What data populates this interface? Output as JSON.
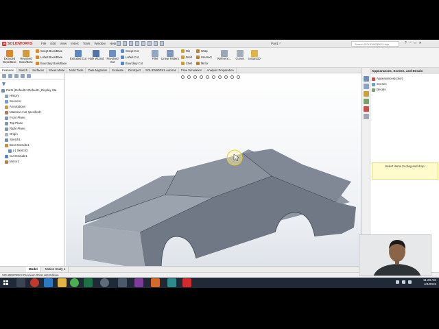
{
  "app": {
    "name": "SOLIDWORKS",
    "document_title": "Part1 *",
    "search_placeholder": "Search SOLIDWORKS Help",
    "menus": [
      "File",
      "Edit",
      "View",
      "Insert",
      "Tools",
      "Window",
      "Help"
    ]
  },
  "command_manager": {
    "extruded_boss": "Extruded Boss/Base",
    "revolved_boss": "Revolved Boss/Base",
    "swept_boss": "Swept Boss/Base",
    "lofted_boss": "Lofted Boss/Base",
    "boundary_boss": "Boundary Boss/Base",
    "extruded_cut": "Extruded Cut",
    "hole_wizard": "Hole Wizard",
    "revolved_cut": "Revolved Cut",
    "swept_cut": "Swept Cut",
    "lofted_cut": "Lofted Cut",
    "boundary_cut": "Boundary Cut",
    "fillet": "Fillet",
    "linear_pattern": "Linear Pattern",
    "rib": "Rib",
    "draft": "Draft",
    "shell": "Shell",
    "wrap": "Wrap",
    "intersect": "Intersect",
    "mirror": "Mirror",
    "reference": "Referenc...",
    "curves": "Curves",
    "instant3d": "Instant3D"
  },
  "tabs": [
    "Features",
    "Sketch",
    "Surfaces",
    "Sheet Metal",
    "Mold Tools",
    "Data Migration",
    "Evaluate",
    "DimXpert",
    "SOLIDWORKS Add-Ins",
    "Flow Simulation",
    "Analysis Preparation"
  ],
  "tree": {
    "root": "Part1 (Default<<Default>_Display Sta",
    "items": [
      {
        "label": "History",
        "indent": 1,
        "icon": "history-icon"
      },
      {
        "label": "Sensors",
        "indent": 1,
        "icon": "sensor-icon"
      },
      {
        "label": "Annotations",
        "indent": 1,
        "icon": "annotation-icon"
      },
      {
        "label": "Material <not specified>",
        "indent": 1,
        "icon": "material-icon"
      },
      {
        "label": "Front Plane",
        "indent": 1,
        "icon": "plane-icon"
      },
      {
        "label": "Top Plane",
        "indent": 1,
        "icon": "plane-icon"
      },
      {
        "label": "Right Plane",
        "indent": 1,
        "icon": "plane-icon"
      },
      {
        "label": "Origin",
        "indent": 1,
        "icon": "origin-icon"
      },
      {
        "label": "Sketch1",
        "indent": 1,
        "icon": "sketch-icon"
      },
      {
        "label": "Boss-Extrude1",
        "indent": 1,
        "icon": "extrude-icon"
      },
      {
        "label": "(-) Sketch3",
        "indent": 2,
        "icon": "sketch-icon"
      },
      {
        "label": "Cut-Extrude1",
        "indent": 1,
        "icon": "cut-icon"
      },
      {
        "label": "Mirror1",
        "indent": 1,
        "icon": "mirror-icon"
      }
    ]
  },
  "task_pane": {
    "title": "Appearances, Scenes, and Decals",
    "items": [
      {
        "label": "Appearances(color)",
        "icon": "appearance-icon"
      },
      {
        "label": "Scenes",
        "icon": "scene-icon"
      },
      {
        "label": "Decals",
        "icon": "decal-icon"
      }
    ],
    "hint": "Select items to drag and drop."
  },
  "bottom_tabs": {
    "model": "Model",
    "motion": "Motion Study 1"
  },
  "status_bar": "SOLIDWORKS Premium 2016 x64 Edition",
  "taskbar": {
    "time": "11:20 AM",
    "date": "4/4/2019"
  },
  "colors": {
    "accent": "#c41f1f",
    "body_color": "#7a8491",
    "taskbar": "#1f2a36"
  }
}
